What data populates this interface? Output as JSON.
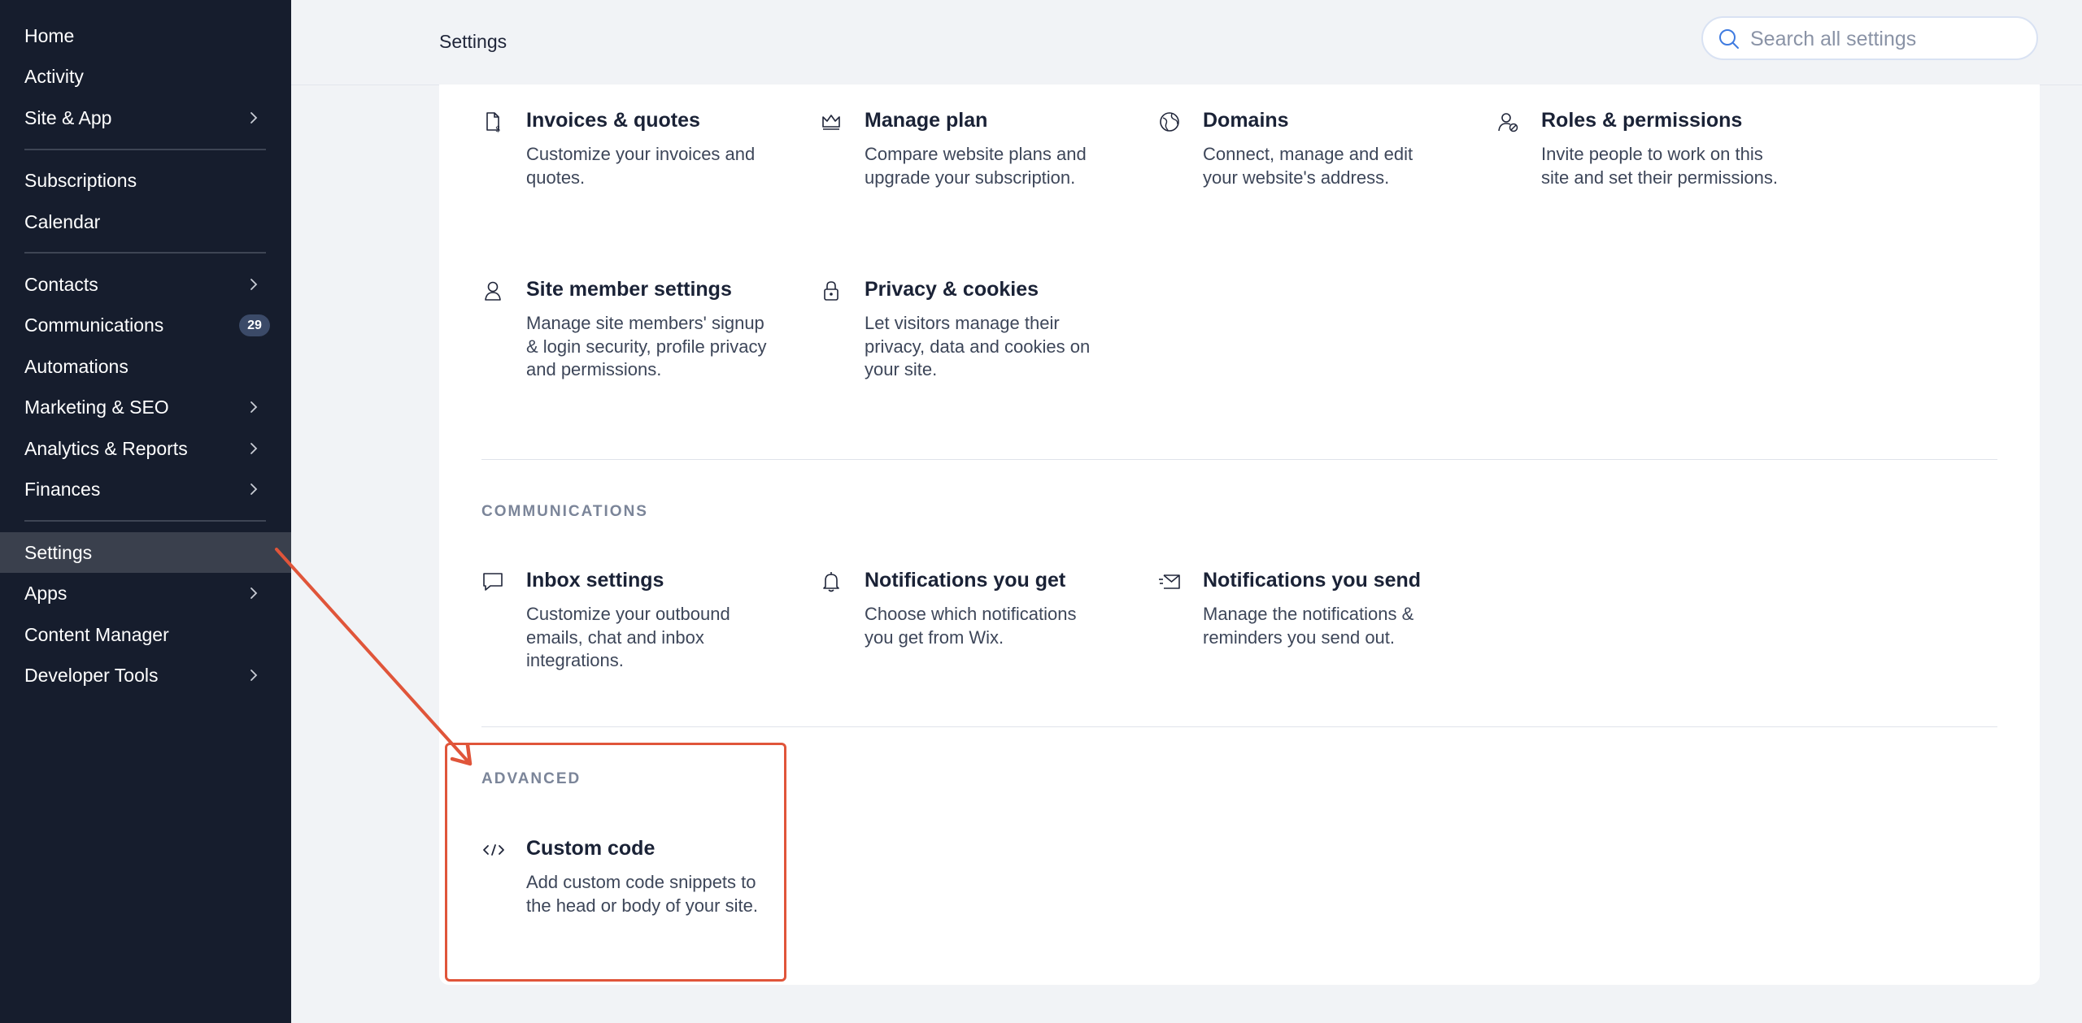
{
  "sidebar": {
    "items": [
      {
        "label": "Home"
      },
      {
        "label": "Activity"
      },
      {
        "label": "Site & App"
      },
      {
        "label": "Subscriptions"
      },
      {
        "label": "Calendar"
      },
      {
        "label": "Contacts"
      },
      {
        "label": "Communications",
        "badge": "29"
      },
      {
        "label": "Automations"
      },
      {
        "label": "Marketing & SEO"
      },
      {
        "label": "Analytics & Reports"
      },
      {
        "label": "Finances"
      },
      {
        "label": "Settings",
        "active": true
      },
      {
        "label": "Apps"
      },
      {
        "label": "Content Manager"
      },
      {
        "label": "Developer Tools"
      }
    ]
  },
  "header": {
    "title": "Settings",
    "search_placeholder": "Search all settings"
  },
  "sections": {
    "general": {
      "cards": [
        {
          "icon": "invoice-icon",
          "title": "Invoices & quotes",
          "desc": "Customize your invoices and quotes."
        },
        {
          "icon": "crown-icon",
          "title": "Manage plan",
          "desc": "Compare website plans and upgrade your subscription."
        },
        {
          "icon": "globe-icon",
          "title": "Domains",
          "desc": "Connect, manage and edit your website's address."
        },
        {
          "icon": "user-permission-icon",
          "title": "Roles & permissions",
          "desc": "Invite people to work on this site and set their permissions."
        },
        {
          "icon": "user-icon",
          "title": "Site member settings",
          "desc": "Manage site members' signup & login security, profile privacy and permissions."
        },
        {
          "icon": "lock-icon",
          "title": "Privacy & cookies",
          "desc": "Let visitors manage their privacy, data and cookies on your site."
        }
      ]
    },
    "communications": {
      "label": "COMMUNICATIONS",
      "cards": [
        {
          "icon": "chat-bubble-icon",
          "title": "Inbox settings",
          "desc": "Customize your outbound emails, chat and inbox integrations."
        },
        {
          "icon": "bell-icon",
          "title": "Notifications you get",
          "desc": "Choose which notifications you get from Wix."
        },
        {
          "icon": "envelope-send-icon",
          "title": "Notifications you send",
          "desc": "Manage the notifications & reminders you send out."
        }
      ]
    },
    "advanced": {
      "label": "ADVANCED",
      "cards": [
        {
          "icon": "code-icon",
          "title": "Custom code",
          "desc": "Add custom code snippets to the head or body of your site."
        }
      ]
    }
  },
  "colors": {
    "sidebar_bg": "#161d2d",
    "sidebar_active": "#3a404d",
    "annotation": "#e0553a",
    "page_bg": "#f1f3f6"
  }
}
